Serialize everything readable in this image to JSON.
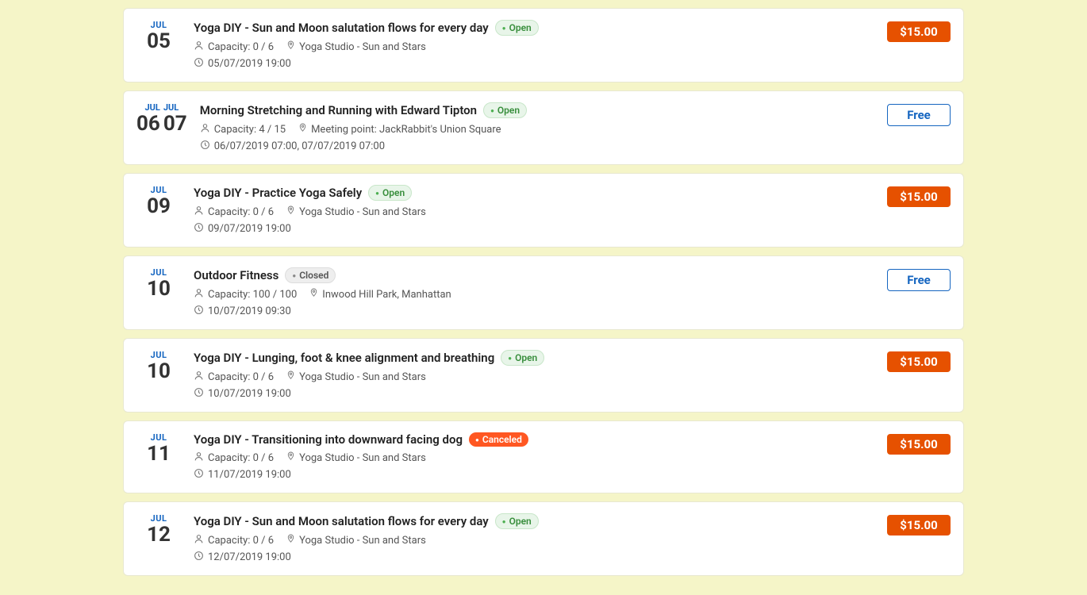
{
  "events": [
    {
      "id": "evt1",
      "month": "JUL",
      "day": "05",
      "title": "Yoga DIY - Sun and Moon salutation flows for every day",
      "status": "Open",
      "status_type": "open",
      "capacity": "Capacity: 0 / 6",
      "location": "Yoga Studio - Sun and Stars",
      "datetime": "05/07/2019 19:00",
      "price": "$15.00",
      "price_type": "paid",
      "double_date": false
    },
    {
      "id": "evt2",
      "month": "JUL",
      "month2": "JUL",
      "day": "06",
      "day2": "07",
      "title": "Morning Stretching and Running with Edward Tipton",
      "status": "Open",
      "status_type": "open",
      "capacity": "Capacity: 4 / 15",
      "location": "Meeting point: JackRabbit's Union Square",
      "datetime": "06/07/2019 07:00, 07/07/2019 07:00",
      "price": "Free",
      "price_type": "free",
      "double_date": true
    },
    {
      "id": "evt3",
      "month": "JUL",
      "day": "09",
      "title": "Yoga DIY - Practice Yoga Safely",
      "status": "Open",
      "status_type": "open",
      "capacity": "Capacity: 0 / 6",
      "location": "Yoga Studio - Sun and Stars",
      "datetime": "09/07/2019 19:00",
      "price": "$15.00",
      "price_type": "paid",
      "double_date": false
    },
    {
      "id": "evt4",
      "month": "JUL",
      "day": "10",
      "title": "Outdoor Fitness",
      "status": "Closed",
      "status_type": "closed",
      "capacity": "Capacity: 100 / 100",
      "location": "Inwood Hill Park, Manhattan",
      "datetime": "10/07/2019 09:30",
      "price": "Free",
      "price_type": "free",
      "double_date": false
    },
    {
      "id": "evt5",
      "month": "JUL",
      "day": "10",
      "title": "Yoga DIY - Lunging, foot & knee alignment and breathing",
      "status": "Open",
      "status_type": "open",
      "capacity": "Capacity: 0 / 6",
      "location": "Yoga Studio - Sun and Stars",
      "datetime": "10/07/2019 19:00",
      "price": "$15.00",
      "price_type": "paid",
      "double_date": false
    },
    {
      "id": "evt6",
      "month": "JUL",
      "day": "11",
      "title": "Yoga DIY - Transitioning into downward facing dog",
      "status": "Canceled",
      "status_type": "canceled",
      "capacity": "Capacity: 0 / 6",
      "location": "Yoga Studio - Sun and Stars",
      "datetime": "11/07/2019 19:00",
      "price": "$15.00",
      "price_type": "paid",
      "double_date": false
    },
    {
      "id": "evt7",
      "month": "JUL",
      "day": "12",
      "title": "Yoga DIY - Sun and Moon salutation flows for every day",
      "status": "Open",
      "status_type": "open",
      "capacity": "Capacity: 0 / 6",
      "location": "Yoga Studio - Sun and Stars",
      "datetime": "12/07/2019 19:00",
      "price": "$15.00",
      "price_type": "paid",
      "double_date": false
    }
  ],
  "icons": {
    "person": "👤",
    "location": "📍",
    "clock": "🕐"
  }
}
